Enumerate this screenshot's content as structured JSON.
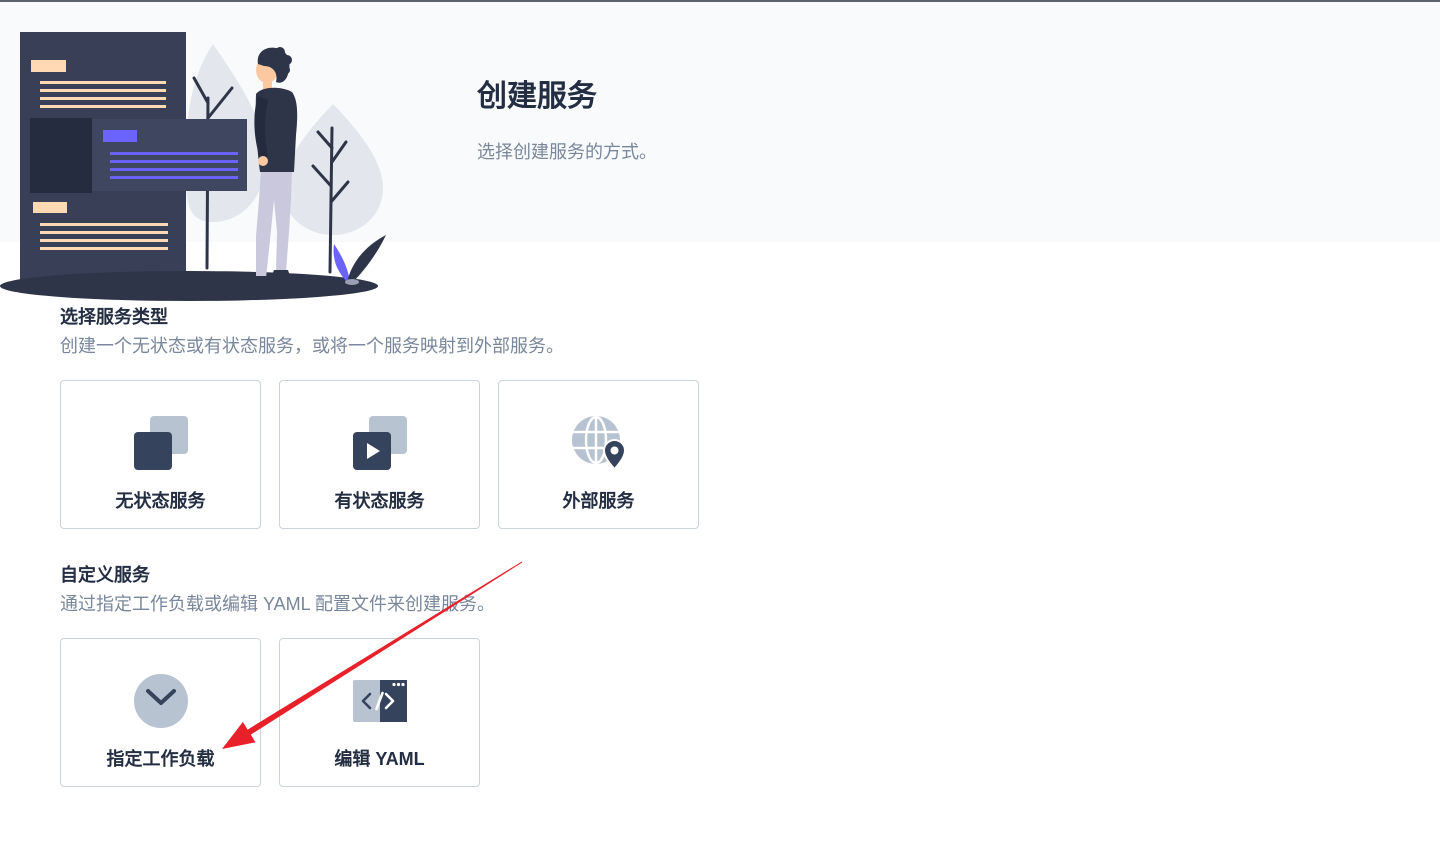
{
  "header": {
    "title": "创建服务",
    "subtitle": "选择创建服务的方式。"
  },
  "sections": [
    {
      "title": "选择服务类型",
      "description": "创建一个无状态或有状态服务，或将一个服务映射到外部服务。",
      "options": [
        {
          "label": "无状态服务",
          "icon": "overlapping-squares-icon"
        },
        {
          "label": "有状态服务",
          "icon": "overlapping-squares-play-icon"
        },
        {
          "label": "外部服务",
          "icon": "globe-location-icon"
        }
      ]
    },
    {
      "title": "自定义服务",
      "description": "通过指定工作负载或编辑 YAML 配置文件来创建服务。",
      "options": [
        {
          "label": "指定工作负载",
          "icon": "chevron-down-circle-icon"
        },
        {
          "label": "编辑 YAML",
          "icon": "code-window-icon"
        }
      ]
    }
  ],
  "colors": {
    "text": "#242e42",
    "muted": "#79879c",
    "card_border": "#ccd3db",
    "banner_bg": "#f9fafb",
    "icon_dark": "#36435c",
    "icon_light": "#b7c3d0",
    "illustration_accent": "#6c63ff",
    "annotation_arrow": "#e8202a"
  }
}
